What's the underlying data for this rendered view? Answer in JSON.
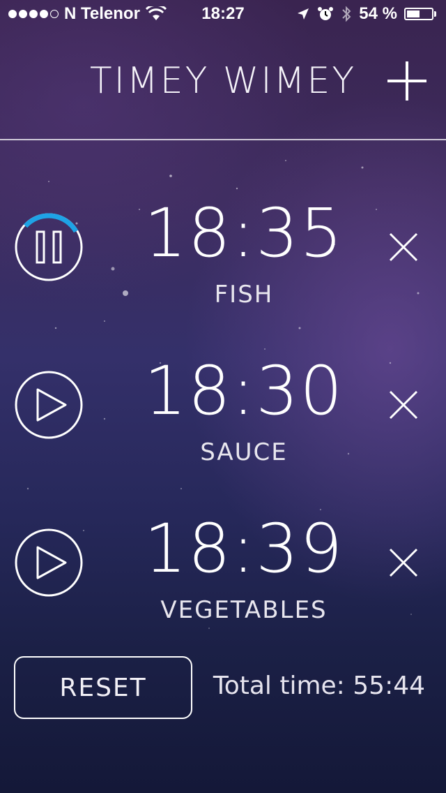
{
  "status_bar": {
    "signal_bars_filled": 4,
    "signal_bars_total": 5,
    "carrier": "N Telenor",
    "time": "18:27",
    "battery": "54 %",
    "battery_level": 0.54,
    "icons": [
      "location-icon",
      "alarm-icon",
      "bluetooth-icon"
    ]
  },
  "header": {
    "title": "TIMEY WIMEY",
    "add_icon": "plus-icon"
  },
  "timers": [
    {
      "time": "18:35",
      "label": "FISH",
      "state": "running",
      "progress": 0.3,
      "close_icon": "close-icon"
    },
    {
      "time": "18:30",
      "label": "SAUCE",
      "state": "paused",
      "close_icon": "close-icon"
    },
    {
      "time": "18:39",
      "label": "VEGETABLES",
      "state": "paused",
      "close_icon": "close-icon"
    }
  ],
  "footer": {
    "reset_label": "RESET",
    "total_time": "Total time: 55:44"
  },
  "colors": {
    "accent": "#1ea3e6",
    "foreground": "#ffffff"
  }
}
